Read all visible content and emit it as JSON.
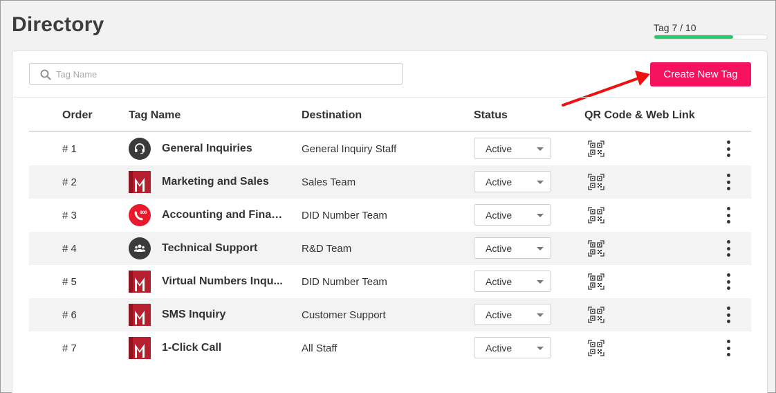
{
  "page": {
    "title": "Directory"
  },
  "tag_usage": {
    "label": "Tag 7 / 10",
    "used": 7,
    "limit": 10,
    "fill_color": "#22cc66"
  },
  "search": {
    "placeholder": "Tag Name",
    "value": ""
  },
  "toolbar": {
    "create_label": "Create New Tag",
    "create_color": "#f5125f"
  },
  "table": {
    "headers": {
      "order": "Order",
      "tag_name": "Tag Name",
      "destination": "Destination",
      "status": "Status",
      "qr": "QR Code & Web Link"
    },
    "rows": [
      {
        "order": "# 1",
        "logo": "headset-icon",
        "name": "General Inquiries",
        "destination": "General Inquiry Staff",
        "status": "Active"
      },
      {
        "order": "# 2",
        "logo": "m-logo",
        "name": "Marketing and Sales",
        "destination": "Sales Team",
        "status": "Active"
      },
      {
        "order": "# 3",
        "logo": "phone-800-icon",
        "name": "Accounting and Finan...",
        "destination": "DID Number Team",
        "status": "Active"
      },
      {
        "order": "# 4",
        "logo": "team-icon",
        "name": "Technical Support",
        "destination": "R&D Team",
        "status": "Active"
      },
      {
        "order": "# 5",
        "logo": "m-logo",
        "name": "Virtual Numbers Inqu...",
        "destination": "DID Number Team",
        "status": "Active"
      },
      {
        "order": "# 6",
        "logo": "m-logo",
        "name": "SMS Inquiry",
        "destination": "Customer Support",
        "status": "Active"
      },
      {
        "order": "# 7",
        "logo": "m-logo",
        "name": "1-Click Call",
        "destination": "All Staff",
        "status": "Active"
      }
    ]
  },
  "icons": {
    "search": "search-icon",
    "qr": "qr-code-icon",
    "more": "more-vertical-icon",
    "annotation": "red-arrow-icon"
  }
}
